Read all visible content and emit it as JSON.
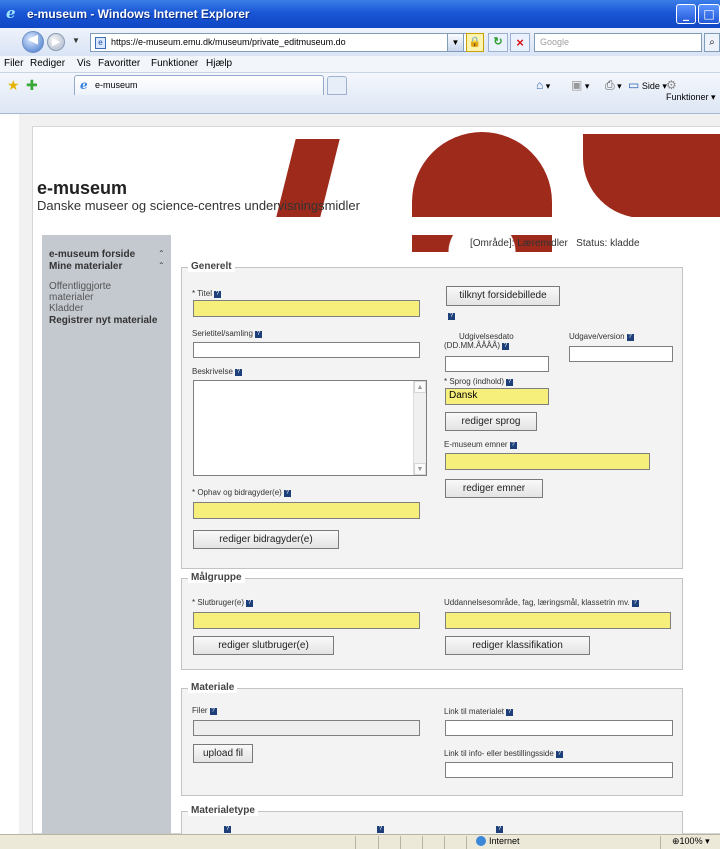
{
  "window": {
    "title": "e-museum - Windows Internet Explorer",
    "url": "https://e-museum.emu.dk/museum/private_editmuseum.do",
    "search_placeholder": "Google",
    "menu": [
      "Filer",
      "Rediger",
      "Vis",
      "Favoritter",
      "Funktioner",
      "Hjælp"
    ],
    "tab_label": "e-museum",
    "tools": {
      "page": "Side",
      "functions": "Funktioner"
    }
  },
  "site": {
    "title": "e-museum",
    "subtitle": "Danske museer og science-centres undervisningsmidler",
    "brand_color": "#9e2a1c"
  },
  "sidebar": {
    "items": [
      {
        "label": "e-museum forside"
      },
      {
        "label": "Mine materialer"
      },
      {
        "label": "Offentliggjorte"
      },
      {
        "label": "materialer"
      },
      {
        "label": "Kladder"
      },
      {
        "label": "Registrer nyt materiale"
      }
    ]
  },
  "status": {
    "area": "[Område]: Læremidler",
    "state": "Status: kladde"
  },
  "generelt": {
    "legend": "Generelt",
    "titel_label": "* Titel",
    "titel_value": "",
    "tilknyt_button": "tilknyt forsidebillede",
    "serietitel_label": "Serietitel/samling",
    "udgivelse_label_1": "Udgivelsesdato",
    "udgivelse_label_2": "(DD.MM.ÅÅÅÅ)",
    "udgave_label": "Udgave/version",
    "beskrivelse_label": "Beskrivelse",
    "sprog_label": "* Sprog (indhold)",
    "sprog_value": "Dansk",
    "rediger_sprog": "rediger sprog",
    "emner_label": "E-museum emner",
    "rediger_emner": "rediger emner",
    "ophav_label": "* Ophav og bidragyder(e)",
    "rediger_bidragyder": "rediger bidragyder(e)"
  },
  "malgruppe": {
    "legend": "Målgruppe",
    "slutbruger_label": "* Slutbruger(e)",
    "uddannelse_label": "Uddannelsesområde, fag, læringsmål, klassetrin mv.",
    "rediger_slutbruger": "rediger slutbruger(e)",
    "rediger_klassifikation": "rediger klassifikation"
  },
  "materiale": {
    "legend": "Materiale",
    "filer_label": "Filer",
    "link_label": "Link til materialet",
    "upload_button": "upload fil",
    "info_label": "Link til info- eller bestillingsside"
  },
  "materialetype": {
    "legend": "Materialetype"
  },
  "statusbar": {
    "zone": "Internet",
    "zoom": "100%"
  }
}
